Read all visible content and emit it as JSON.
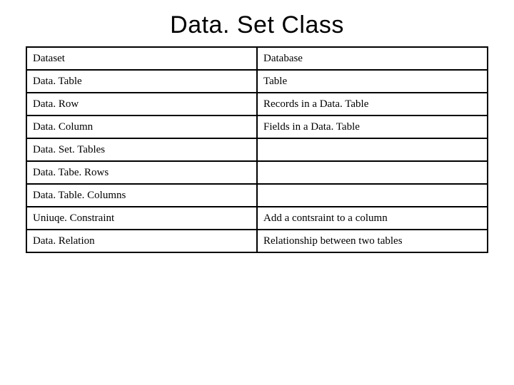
{
  "title": "Data. Set Class",
  "rows": [
    {
      "left": "Dataset",
      "right": "Database"
    },
    {
      "left": "Data. Table",
      "right": "Table"
    },
    {
      "left": "Data. Row",
      "right": "Records in a Data. Table"
    },
    {
      "left": "Data. Column",
      "right": "Fields in a Data. Table"
    },
    {
      "left": "Data. Set. Tables",
      "right": ""
    },
    {
      "left": "Data. Tabe. Rows",
      "right": ""
    },
    {
      "left": "Data. Table. Columns",
      "right": ""
    },
    {
      "left": "Uniuqe. Constraint",
      "right": "Add a contsraint to a column"
    },
    {
      "left": "Data. Relation",
      "right": "Relationship between two tables"
    }
  ]
}
